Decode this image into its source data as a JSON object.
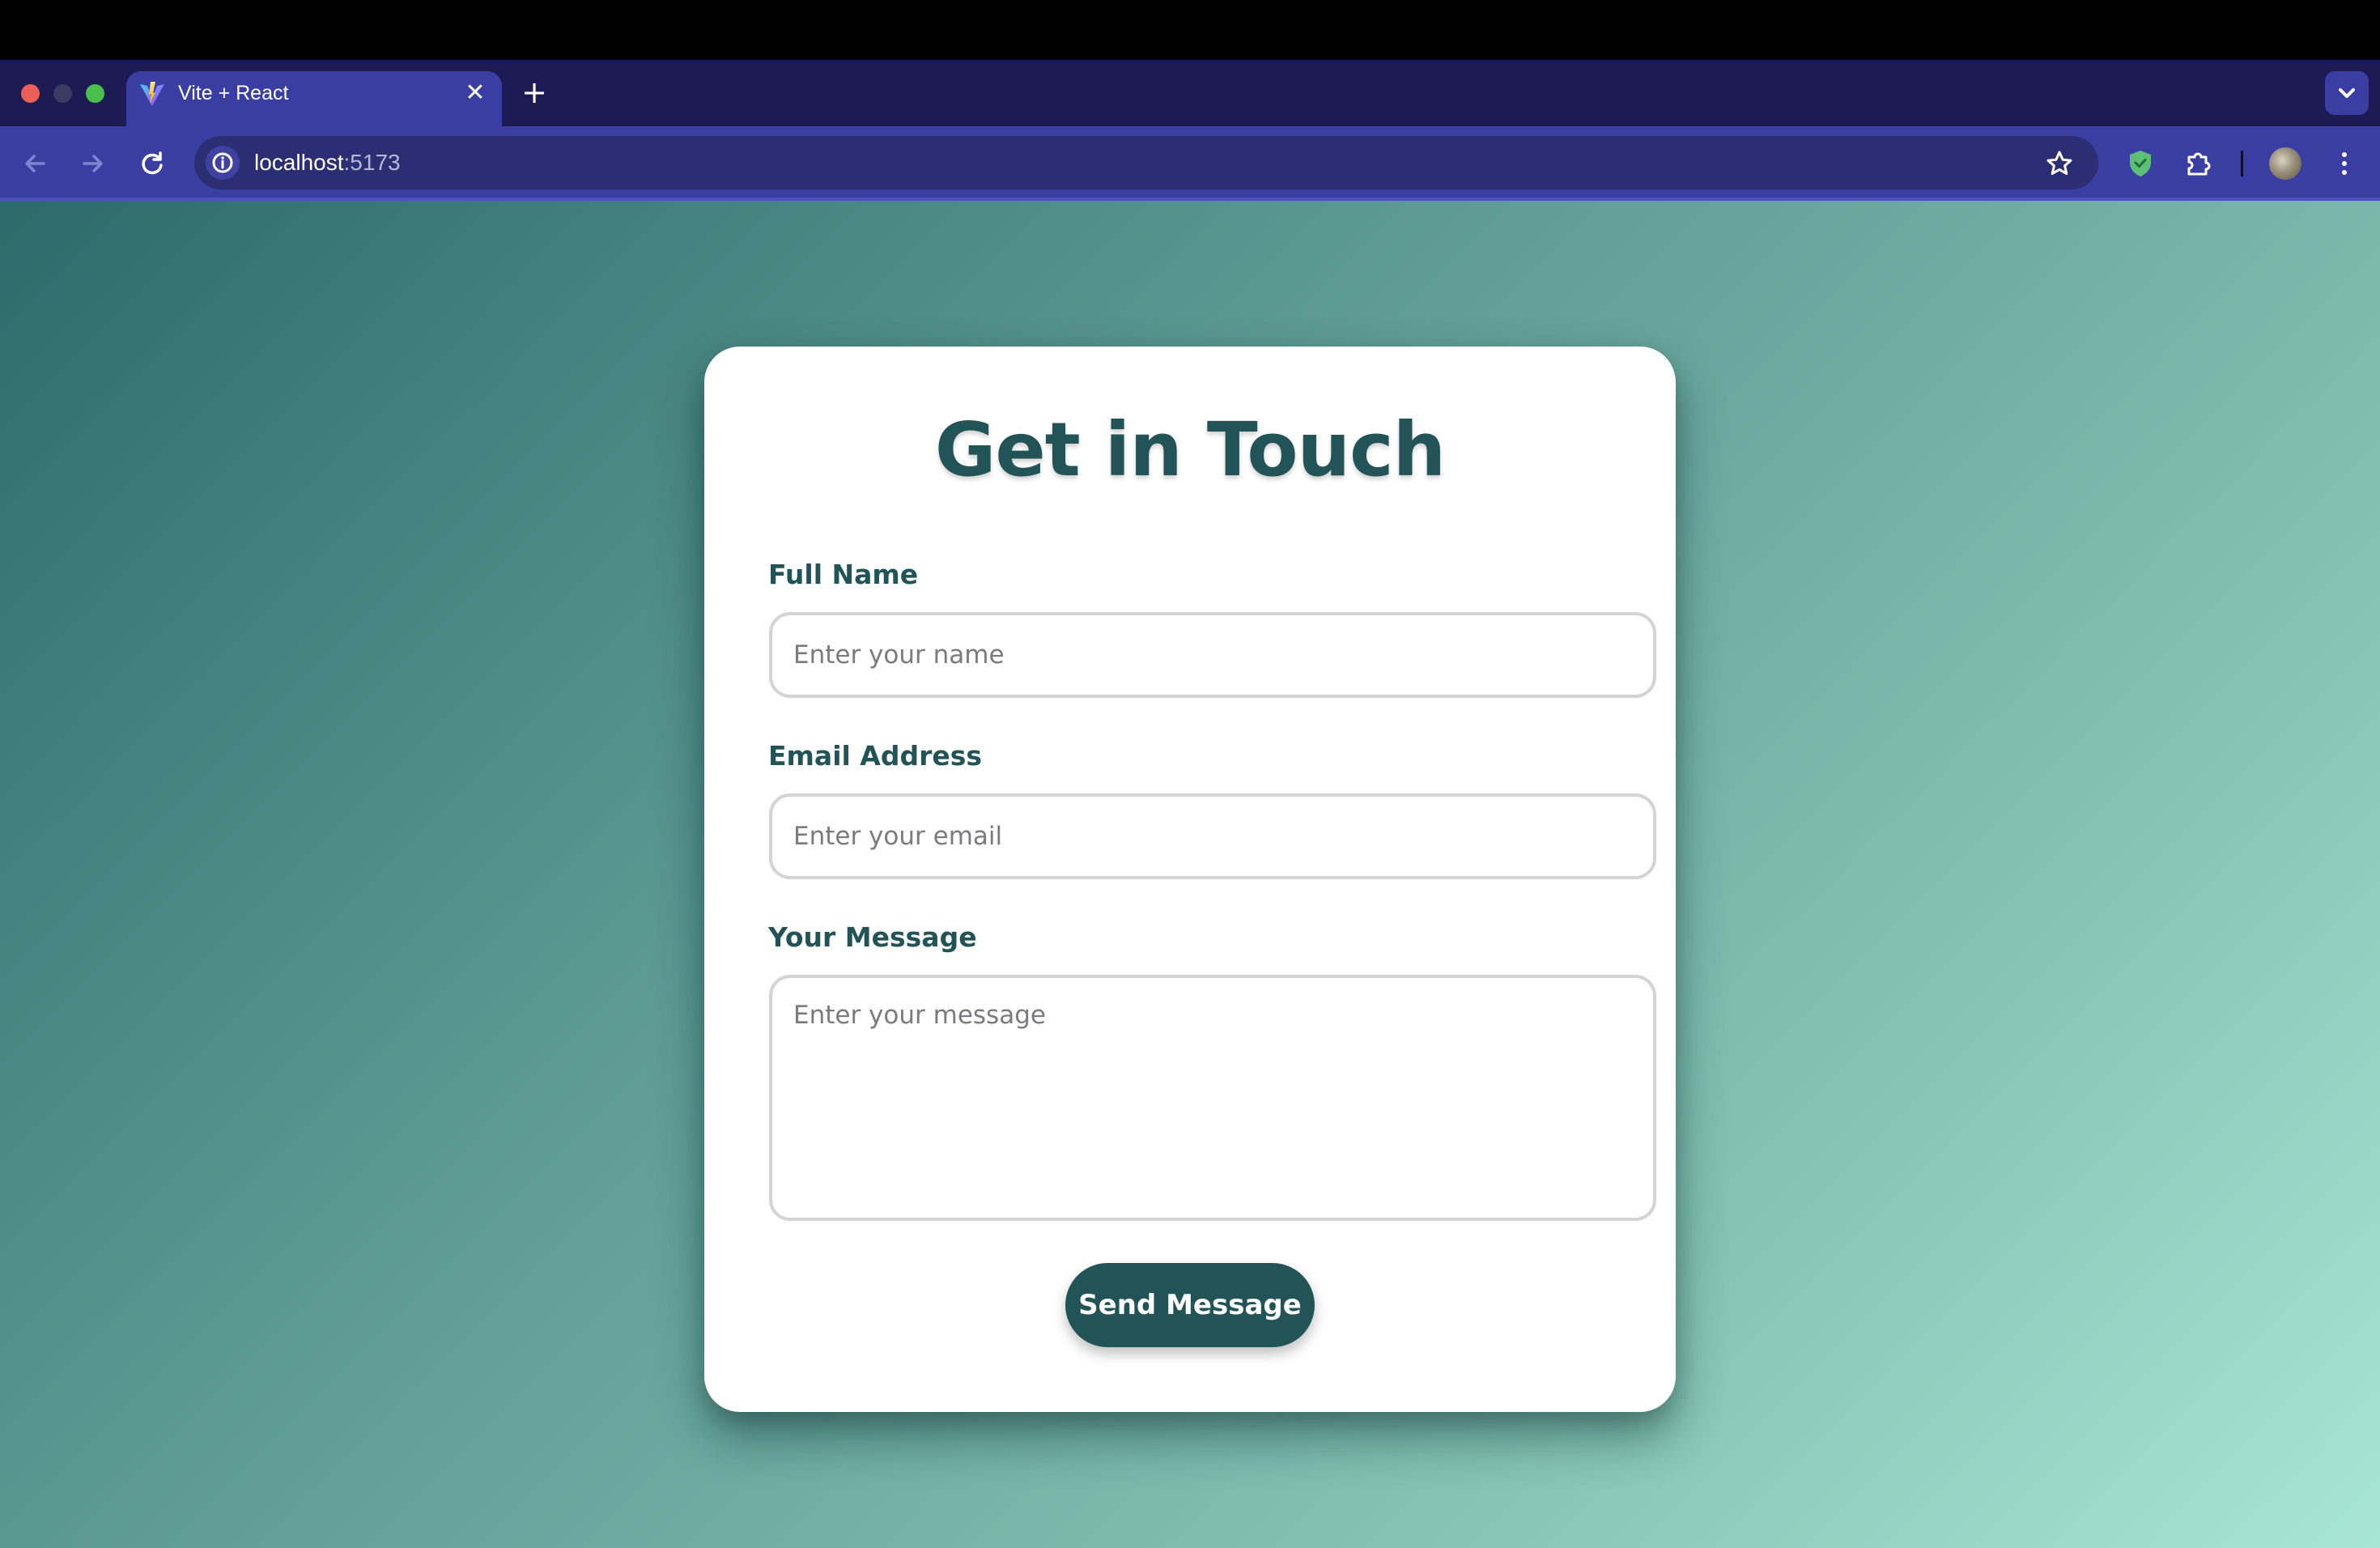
{
  "browser": {
    "tab": {
      "title": "Vite + React",
      "close_glyph": "✕",
      "favicon": "vite-icon"
    },
    "new_tab_glyph": "+",
    "address": {
      "host": "localhost",
      "port": ":5173"
    },
    "icons": {
      "back": "back-arrow-icon",
      "forward": "forward-arrow-icon",
      "reload": "reload-icon",
      "info": "info-icon",
      "bookmark": "star-icon",
      "shield": "shield-icon",
      "extensions": "puzzle-icon",
      "menu": "more-vert-icon",
      "tab_search": "chevron-down-icon"
    },
    "colors": {
      "tabstrip": "#1c1a52",
      "toolbar": "#3a3ea3",
      "omnibox": "#2c2e73"
    }
  },
  "page": {
    "title": "Get in Touch",
    "form": {
      "name": {
        "label": "Full Name",
        "placeholder": "Enter your name"
      },
      "email": {
        "label": "Email Address",
        "placeholder": "Enter your email"
      },
      "message": {
        "label": "Your Message",
        "placeholder": "Enter your message"
      },
      "submit_label": "Send Message"
    },
    "colors": {
      "accent": "#225457",
      "gradient_start": "#2c6b6b",
      "gradient_end": "#a7e6d4",
      "card": "#ffffff"
    }
  }
}
